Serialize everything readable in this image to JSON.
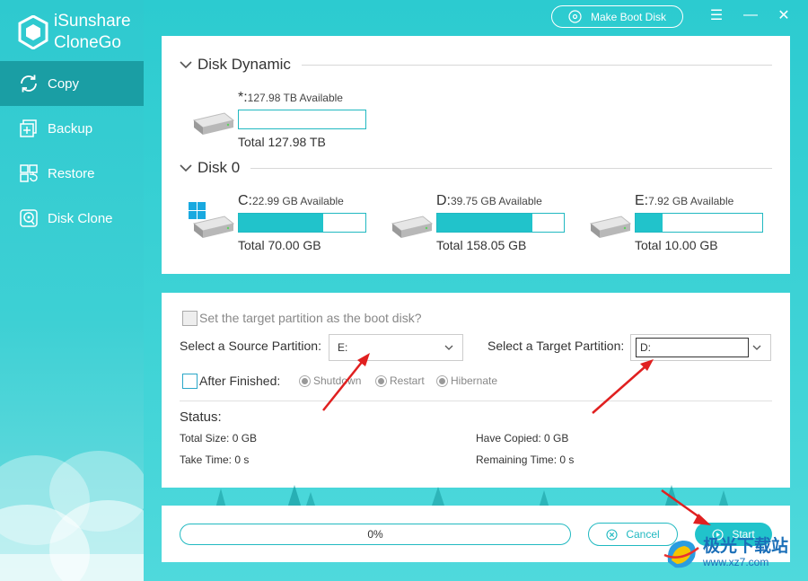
{
  "app": {
    "title_line1": "iSunshare",
    "title_line2": "CloneGo",
    "make_boot_disk": "Make Boot Disk",
    "minimize_glyph": "—",
    "menu_glyph": "☰",
    "close_glyph": "✕"
  },
  "sidebar": {
    "items": [
      {
        "label": "Copy",
        "icon": "copy-sync-icon",
        "active": true
      },
      {
        "label": "Backup",
        "icon": "backup-icon",
        "active": false
      },
      {
        "label": "Restore",
        "icon": "restore-icon",
        "active": false
      },
      {
        "label": "Disk Clone",
        "icon": "disk-clone-icon",
        "active": false
      }
    ]
  },
  "disk_dynamic": {
    "title": "Disk Dynamic",
    "partitions": [
      {
        "letter": "*:",
        "available": "127.98 TB Available",
        "total": "Total 127.98 TB",
        "used_fraction": 0
      }
    ]
  },
  "disk0": {
    "title": "Disk 0",
    "partitions": [
      {
        "letter": "C:",
        "available": "22.99 GB Available",
        "total": "Total 70.00 GB",
        "used_fraction": 0.67,
        "windows": true
      },
      {
        "letter": "D:",
        "available": "39.75 GB Available",
        "total": "Total 158.05 GB",
        "used_fraction": 0.75
      },
      {
        "letter": "E:",
        "available": "7.92 GB Available",
        "total": "Total 10.00 GB",
        "used_fraction": 0.21
      }
    ]
  },
  "options": {
    "boot_disk_label": "Set the target partition as the boot disk?",
    "source_label": "Select a Source Partition:",
    "source_value": "E:",
    "target_label": "Select a Target Partition:",
    "target_value": "D:",
    "after_finished_label": "After Finished:",
    "radios": [
      "Shutdown",
      "Restart",
      "Hibernate"
    ]
  },
  "status": {
    "title": "Status:",
    "total_size": "Total Size: 0 GB",
    "have_copied": "Have Copied: 0 GB",
    "take_time": "Take Time: 0 s",
    "remaining_time": "Remaining Time: 0 s"
  },
  "bottom": {
    "progress_text": "0%",
    "progress_value": 0,
    "cancel": "Cancel",
    "start": "Start"
  },
  "watermark": {
    "cn": "极光下载站",
    "url": "www.xz7.com"
  },
  "colors": {
    "accent": "#21c3cb",
    "sidebar_active": "#1a9ea4",
    "annotation_arrow": "#e02020"
  }
}
